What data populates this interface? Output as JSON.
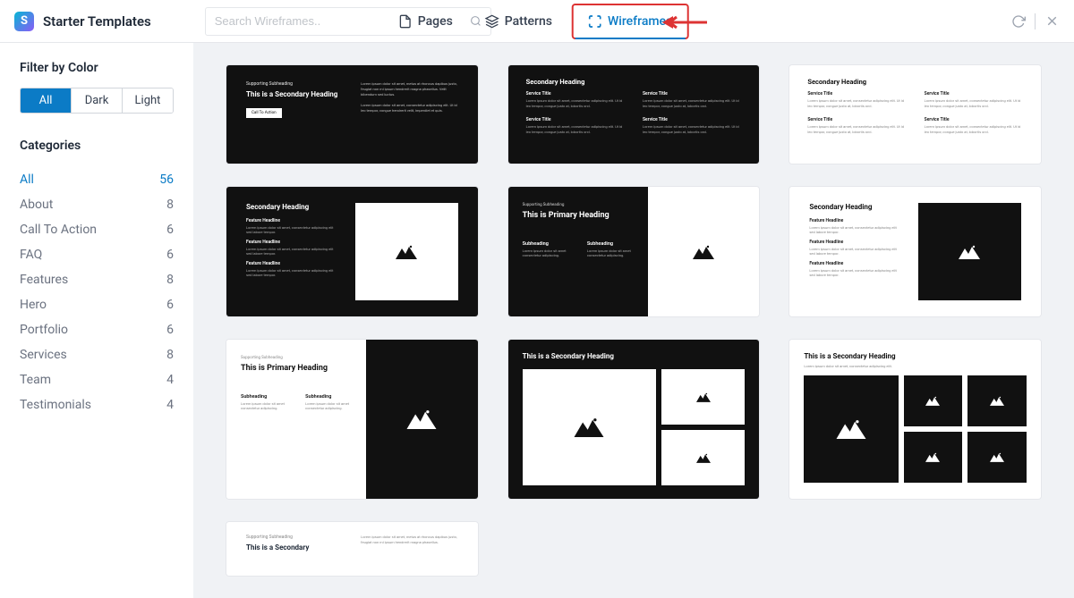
{
  "header": {
    "title": "Starter Templates",
    "nav": {
      "pages": "Pages",
      "patterns": "Patterns",
      "wireframes": "Wireframes"
    },
    "search_placeholder": "Search Wireframes.."
  },
  "sidebar": {
    "filter_title": "Filter by Color",
    "filters": {
      "all": "All",
      "dark": "Dark",
      "light": "Light"
    },
    "categories_title": "Categories",
    "categories": [
      {
        "label": "All",
        "count": "56",
        "active": true
      },
      {
        "label": "About",
        "count": "8"
      },
      {
        "label": "Call To Action",
        "count": "6"
      },
      {
        "label": "FAQ",
        "count": "6"
      },
      {
        "label": "Features",
        "count": "8"
      },
      {
        "label": "Hero",
        "count": "6"
      },
      {
        "label": "Portfolio",
        "count": "6"
      },
      {
        "label": "Services",
        "count": "8"
      },
      {
        "label": "Team",
        "count": "4"
      },
      {
        "label": "Testimonials",
        "count": "4"
      }
    ]
  },
  "cards": {
    "c1": {
      "sup": "Supporting Subheading",
      "h": "This is a Secondary Heading",
      "p1": "Lorem ipsum dolor sit amet, metus at rhoncus dapibus justo, feugiat non mi ipsum hendrerit magna phasellus. Velit bibendum sed luctus.",
      "p2": "Lorem ipsum dolor sit amet, consectetur adipiscing elit. Ut id leo tempor, congue hendrerit velit, imperdiet et quis.",
      "btn": "Call To Action"
    },
    "c2": {
      "h": "Secondary Heading",
      "st": "Service Title",
      "desc": "Lorem ipsum dolor sit amet, consectetur adipiscing elit. Ut id leo tempor, congue justo at, lobortis orci."
    },
    "c3": {
      "h": "Secondary Heading",
      "st": "Service Title",
      "desc": "Lorem ipsum dolor sit amet, consectetur adipiscing elit. Ut id leo tempor, congue justo at, lobortis orci."
    },
    "c4": {
      "h": "Secondary Heading",
      "fh": "Feature Headline",
      "desc": "Lorem ipsum dolor sit amet, consectetur adipiscing elit sed labore tempor."
    },
    "c5": {
      "sup": "Supporting Subheading",
      "h": "This is Primary Heading",
      "sh": "Subheading",
      "desc": "Lorem ipsum dolor sit amet consectetur adipiscing."
    },
    "c6": {
      "h": "Secondary Heading",
      "fh": "Feature Headline",
      "desc": "Lorem ipsum dolor sit amet, consectetur adipiscing elit sed labore tempor."
    },
    "c7": {
      "sup": "Supporting Subheading",
      "h": "This is Primary Heading",
      "sh": "Subheading",
      "desc": "Lorem ipsum dolor sit amet consectetur adipiscing."
    },
    "c8": {
      "h": "This is a Secondary Heading"
    },
    "c9": {
      "h": "This is a Secondary Heading",
      "desc": "Lorem ipsum dolor sit amet, consectetur adipiscing elit."
    },
    "c10": {
      "sup": "Supporting Subheading",
      "h": "This is a Secondary",
      "p": "Lorem ipsum dolor sit amet, metus at rhoncus dapibus justo, feugiat non mi ipsum hendrerit magna phasellus."
    }
  }
}
